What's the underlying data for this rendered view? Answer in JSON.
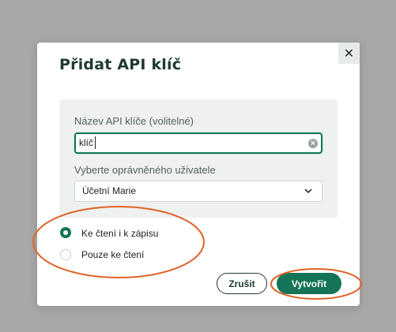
{
  "dialog": {
    "title": "Přidat API klíč",
    "close_icon": "close-icon"
  },
  "form": {
    "api_key_name_label": "Název API klíče (volitelné)",
    "api_key_name_value": "klíč",
    "user_label": "Vyberte oprávněného uživatele",
    "user_selected": "Účetní Marie"
  },
  "permissions": {
    "options": [
      {
        "label": "Ke čtení i k zápisu",
        "checked": true
      },
      {
        "label": "Pouze ke čtení",
        "checked": false
      }
    ]
  },
  "buttons": {
    "cancel": "Zrušit",
    "create": "Vytvořit"
  },
  "colors": {
    "accent": "#157458",
    "annotation": "#e0642a",
    "title": "#1d3a30"
  }
}
